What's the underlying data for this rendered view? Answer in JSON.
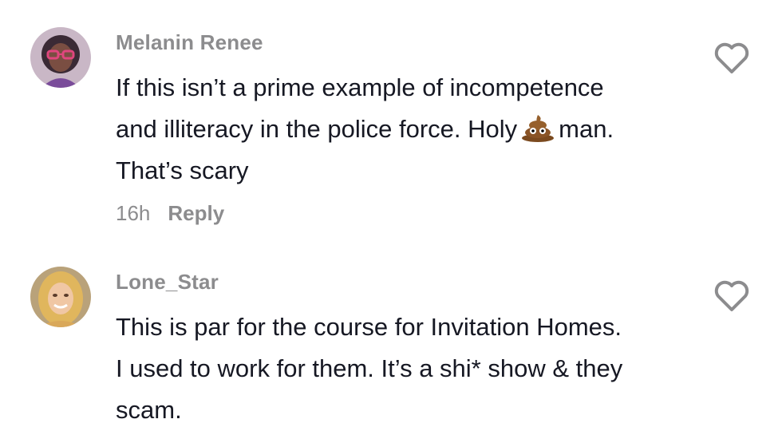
{
  "comments": [
    {
      "username": "Melanin Renee",
      "text_line1": "If this isn’t a prime example of incompetence",
      "text_line2_before": "and illiteracy in the police force. Holy",
      "text_line2_after": "man.",
      "text_line3": "That’s scary",
      "emoji": "pile-of-poo",
      "time": "16h",
      "reply_label": "Reply"
    },
    {
      "username": "Lone_Star",
      "text_line1": "This is par for the course for Invitation Homes.",
      "text_line2": "I used to work for them. It’s a shi* show & they",
      "text_line3": "scam."
    }
  ],
  "icons": {
    "like": "heart-outline-icon"
  },
  "colors": {
    "username": "#8c8c8e",
    "text": "#161823",
    "meta": "#8c8c8e"
  }
}
